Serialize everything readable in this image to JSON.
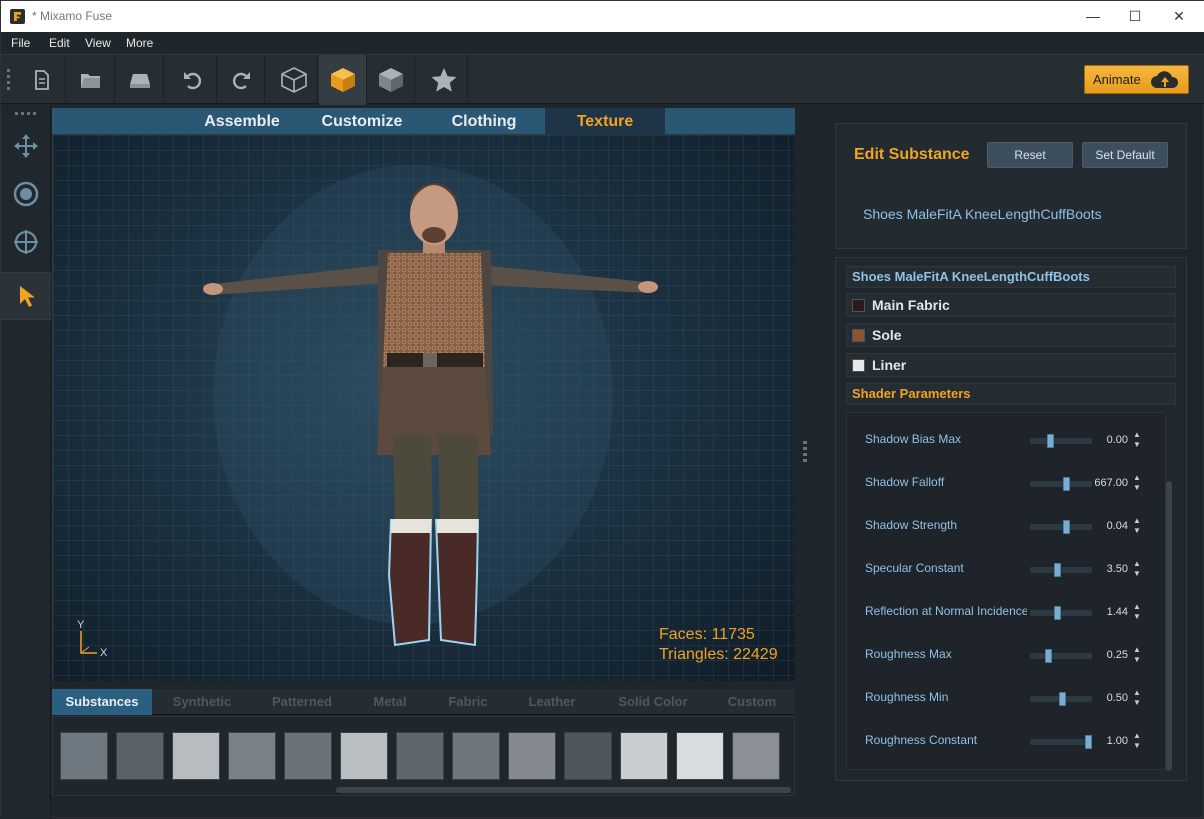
{
  "window": {
    "title": "* Mixamo Fuse",
    "minimize": "—",
    "maximize": "☐",
    "close": "✕"
  },
  "menu": [
    "File",
    "Edit",
    "View",
    "More"
  ],
  "toolbar": {
    "icons": [
      "new-file-icon",
      "open-folder-icon",
      "save-drive-icon",
      "undo-icon",
      "redo-icon",
      "wireframe-cube-icon",
      "solid-cube-icon",
      "shaded-cube-icon",
      "favorite-star-icon"
    ],
    "animate_label": "Animate"
  },
  "left_tools": [
    "move-icon",
    "rotate-icon",
    "target-icon",
    "select-arrow-icon"
  ],
  "tabs": [
    {
      "label": "Assemble",
      "active": false
    },
    {
      "label": "Customize",
      "active": false
    },
    {
      "label": "Clothing",
      "active": false
    },
    {
      "label": "Texture",
      "active": true
    }
  ],
  "viewport": {
    "faces": "Faces: 11735",
    "triangles": "Triangles: 22429",
    "axis_y": "Y",
    "axis_x": "X"
  },
  "material_tabs": [
    {
      "label": "Substances",
      "active": true
    },
    {
      "label": "Synthetic",
      "active": false
    },
    {
      "label": "Patterned",
      "active": false
    },
    {
      "label": "Metal",
      "active": false
    },
    {
      "label": "Fabric",
      "active": false
    },
    {
      "label": "Leather",
      "active": false
    },
    {
      "label": "Solid Color",
      "active": false
    },
    {
      "label": "Custom",
      "active": false
    }
  ],
  "swatch_colors": [
    "#6e7880",
    "#5a6169",
    "#b7bcc0",
    "#7a8288",
    "#6b7278",
    "#b9bec2",
    "#5f676d",
    "#6e767c",
    "#83898e",
    "#4f575d",
    "#c9cdd0",
    "#d9dcde",
    "#8a9095"
  ],
  "edit_substance": {
    "heading": "Edit Substance",
    "reset_label": "Reset",
    "set_default_label": "Set Default",
    "object_name": "Shoes MaleFitA KneeLengthCuffBoots"
  },
  "properties": {
    "group_header": "Shoes MaleFitA KneeLengthCuffBoots",
    "materials": [
      {
        "label": "Main Fabric",
        "color": "#2a1a1a"
      },
      {
        "label": "Sole",
        "color": "#8a5530"
      },
      {
        "label": "Liner",
        "color": "#e8e8e8"
      }
    ],
    "shader_header": "Shader Parameters",
    "parameters": [
      {
        "label": "Shadow Bias Max",
        "value": "0.00",
        "level": 0.3
      },
      {
        "label": "Shadow Falloff",
        "value": "667.00",
        "level": 0.57
      },
      {
        "label": "Shadow Strength",
        "value": "0.04",
        "level": 0.57
      },
      {
        "label": "Specular Constant",
        "value": "3.50",
        "level": 0.42
      },
      {
        "label": "Reflection at Normal Incidence",
        "value": "1.44",
        "level": 0.42
      },
      {
        "label": "Roughness Max",
        "value": "0.25",
        "level": 0.25
      },
      {
        "label": "Roughness Min",
        "value": "0.50",
        "level": 0.5
      },
      {
        "label": "Roughness Constant",
        "value": "1.00",
        "level": 0.95
      }
    ]
  }
}
